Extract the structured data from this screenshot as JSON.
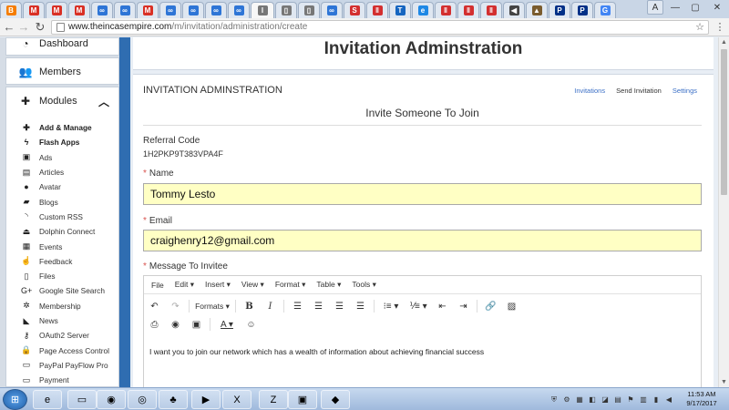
{
  "browser": {
    "tabs": [
      {
        "icon": "blogger-icon",
        "glyph": "B",
        "color": "#f57d00"
      },
      {
        "icon": "gmail-icon",
        "glyph": "M",
        "color": "#d93025"
      },
      {
        "icon": "gmail-icon",
        "glyph": "M",
        "color": "#d93025"
      },
      {
        "icon": "gmail-icon",
        "glyph": "M",
        "color": "#d93025"
      },
      {
        "icon": "infinity-icon",
        "glyph": "∞",
        "color": "#2e75d6"
      },
      {
        "icon": "infinity-icon",
        "glyph": "∞",
        "color": "#2e75d6"
      },
      {
        "icon": "gmail-icon",
        "glyph": "M",
        "color": "#d93025"
      },
      {
        "icon": "infinity-icon",
        "glyph": "∞",
        "color": "#2e75d6"
      },
      {
        "icon": "infinity-icon",
        "glyph": "∞",
        "color": "#2e75d6"
      },
      {
        "icon": "infinity-icon",
        "glyph": "∞",
        "color": "#2e75d6"
      },
      {
        "icon": "infinity-icon",
        "glyph": "∞",
        "color": "#2e75d6"
      },
      {
        "icon": "page-icon",
        "glyph": "I",
        "color": "#777777"
      },
      {
        "icon": "page-icon",
        "glyph": "▯",
        "color": "#777777"
      },
      {
        "icon": "page-icon",
        "glyph": "▯",
        "color": "#777777"
      },
      {
        "icon": "infinity-icon",
        "glyph": "∞",
        "color": "#2e75d6"
      },
      {
        "icon": "s-logo-icon",
        "glyph": "S",
        "color": "#d32f2f"
      },
      {
        "icon": "pause-icon",
        "glyph": "‖",
        "color": "#d32f2f"
      },
      {
        "icon": "t-logo-icon",
        "glyph": "T",
        "color": "#1565c0"
      },
      {
        "icon": "edge-icon",
        "glyph": "e",
        "color": "#1e88e5"
      },
      {
        "icon": "pause-icon",
        "glyph": "‖",
        "color": "#d32f2f"
      },
      {
        "icon": "pause-icon",
        "glyph": "‖",
        "color": "#d32f2f"
      },
      {
        "icon": "pause-icon",
        "glyph": "‖",
        "color": "#d32f2f"
      },
      {
        "icon": "speaker-icon",
        "glyph": "◀",
        "color": "#444444"
      },
      {
        "icon": "app-icon",
        "glyph": "▲",
        "color": "#7a5c2e"
      },
      {
        "icon": "paypal-icon",
        "glyph": "P",
        "color": "#003087"
      },
      {
        "icon": "paypal-icon",
        "glyph": "P",
        "color": "#003087"
      },
      {
        "icon": "google-icon",
        "glyph": "G",
        "color": "#4285f4"
      }
    ],
    "user_initials": "A",
    "url_host": "www.theincasempire.com",
    "url_path": "/m/invitation/administration/create"
  },
  "sidebar": {
    "dashboard": {
      "label": "Dashboard",
      "icon": "dashboard-icon"
    },
    "members": {
      "label": "Members",
      "icon": "users-icon"
    },
    "modules": {
      "label": "Modules",
      "icon": "puzzle-icon",
      "items": [
        {
          "label": "Add & Manage",
          "icon": "plus-icon",
          "bold": true
        },
        {
          "label": "Flash Apps",
          "icon": "flash-icon",
          "bold": true
        },
        {
          "label": "Ads",
          "icon": "ad-icon",
          "bold": false
        },
        {
          "label": "Articles",
          "icon": "file-text-icon",
          "bold": false
        },
        {
          "label": "Avatar",
          "icon": "user-icon",
          "bold": false
        },
        {
          "label": "Blogs",
          "icon": "book-icon",
          "bold": false
        },
        {
          "label": "Custom RSS",
          "icon": "rss-icon",
          "bold": false
        },
        {
          "label": "Dolphin Connect",
          "icon": "plug-icon",
          "bold": false
        },
        {
          "label": "Events",
          "icon": "calendar-icon",
          "bold": false
        },
        {
          "label": "Feedback",
          "icon": "thumbs-up-icon",
          "bold": false
        },
        {
          "label": "Files",
          "icon": "file-icon",
          "bold": false
        },
        {
          "label": "Google Site Search",
          "icon": "google-plus-icon",
          "bold": false
        },
        {
          "label": "Membership",
          "icon": "gear-icon",
          "bold": false
        },
        {
          "label": "News",
          "icon": "bullhorn-icon",
          "bold": false
        },
        {
          "label": "OAuth2 Server",
          "icon": "key-icon",
          "bold": false
        },
        {
          "label": "Page Access Control",
          "icon": "lock-icon",
          "bold": false
        },
        {
          "label": "PayPal PayFlow Pro",
          "icon": "card-icon",
          "bold": false
        },
        {
          "label": "Payment",
          "icon": "credit-card-icon",
          "bold": false
        }
      ]
    }
  },
  "page": {
    "title": "Invitation Adminstration",
    "section_heading": "INVITATION ADMINSTRATION",
    "links": [
      {
        "label": "Invitations",
        "current": false
      },
      {
        "label": "Send Invitation",
        "current": true
      },
      {
        "label": "Settings",
        "current": false
      }
    ],
    "subtitle": "Invite Someone To Join",
    "referral": {
      "label": "Referral Code",
      "value": "1H2PKP9T383VPA4F"
    },
    "name": {
      "label": "Name",
      "value": "Tommy Lesto"
    },
    "email": {
      "label": "Email",
      "value": "craighenry12@gmail.com"
    },
    "message": {
      "label": "Message To Invitee",
      "menus": [
        "File",
        "Edit",
        "Insert",
        "View",
        "Format",
        "Table",
        "Tools"
      ],
      "formats_label": "Formats",
      "body": "I want you to join our network which has a wealth of information about achieving financial success"
    }
  },
  "taskbar": {
    "apps": [
      {
        "icon": "ie-icon",
        "glyph": "e"
      },
      {
        "icon": "folder-icon",
        "glyph": "▭"
      },
      {
        "icon": "firefox-icon",
        "glyph": "◉"
      },
      {
        "icon": "chrome-icon",
        "glyph": "◎"
      },
      {
        "icon": "frog-icon",
        "glyph": "♣"
      },
      {
        "icon": "media-player-icon",
        "glyph": "▶"
      },
      {
        "icon": "excel-icon",
        "glyph": "X"
      },
      {
        "icon": "filezilla-icon",
        "glyph": "Z"
      },
      {
        "icon": "app-window-icon",
        "glyph": "▣"
      },
      {
        "icon": "eraser-icon",
        "glyph": "◆"
      }
    ],
    "time": "11:53 AM",
    "date": "9/17/2017"
  },
  "colors": {
    "sidebar_accent": "#2f6db1",
    "field_highlight": "#ffffc4",
    "link": "#3b6fc6",
    "required": "#d9534f"
  }
}
